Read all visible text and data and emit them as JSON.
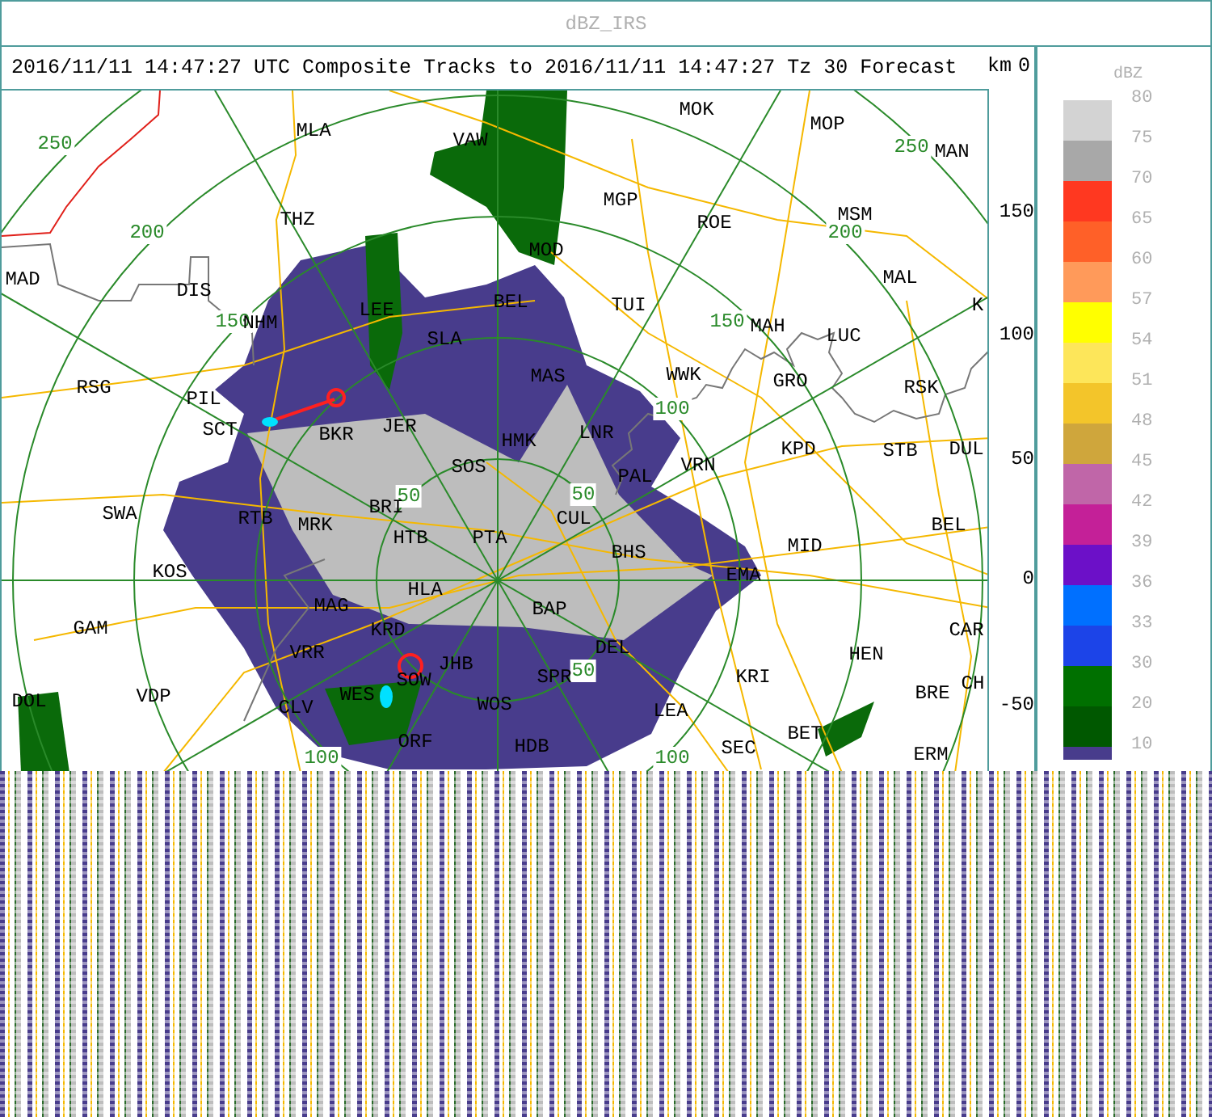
{
  "header": {
    "title": "dBZ_IRS"
  },
  "plot": {
    "title": "2016/11/11 14:47:27 UTC Composite Tracks to 2016/11/11 14:47:27 Tz 30 Forecast",
    "unit": "km",
    "corner_value": "0",
    "range_labels": [
      "250",
      "200",
      "150",
      "250",
      "200",
      "150",
      "100",
      "50",
      "100",
      "50",
      "50",
      "100"
    ],
    "stations": [
      "MOK",
      "MLA",
      "VAW",
      "MOP",
      "MAN",
      "MGP",
      "THZ",
      "ROE",
      "MSM",
      "MOD",
      "MAD",
      "MAL",
      "DIS",
      "LEE",
      "BEL",
      "TUI",
      "K",
      "NHM",
      "MAH",
      "SLA",
      "LUC",
      "MAS",
      "WWK",
      "GRO",
      "RSG",
      "RSK",
      "PIL",
      "SCT",
      "BKR",
      "JER",
      "HMK",
      "LNR",
      "KPD",
      "STB",
      "DUL",
      "SOS",
      "VRN",
      "PAL",
      "BRI",
      "SWA",
      "RTB",
      "MRK",
      "CUL",
      "BEL",
      "HTB",
      "PTA",
      "MID",
      "BHS",
      "KOS",
      "EMA",
      "HLA",
      "MAG",
      "BAP",
      "GAM",
      "KRD",
      "CAR",
      "VRR",
      "DEL",
      "HEN",
      "JHB",
      "SOW",
      "SPR",
      "KRI",
      "CH",
      "DOL",
      "VDP",
      "CLV",
      "WES",
      "WOS",
      "LEA",
      "BRE",
      "BET",
      "ORF",
      "HDB",
      "SEC",
      "ERM"
    ],
    "y_axis_labels": [
      "150",
      "100",
      "50",
      "0",
      "-50"
    ]
  },
  "legend": {
    "title": "dBZ",
    "bins": [
      {
        "label": "80",
        "color": "#d3d3d3"
      },
      {
        "label": "75",
        "color": "#a8a8a8"
      },
      {
        "label": "70",
        "color": "#ff3820"
      },
      {
        "label": "65",
        "color": "#ff6028"
      },
      {
        "label": "60",
        "color": "#ff9a5a"
      },
      {
        "label": "57",
        "color": "#ffff00"
      },
      {
        "label": "54",
        "color": "#fde65a"
      },
      {
        "label": "51",
        "color": "#f3c52a"
      },
      {
        "label": "48",
        "color": "#cfa63c"
      },
      {
        "label": "45",
        "color": "#c066a8"
      },
      {
        "label": "42",
        "color": "#c42098"
      },
      {
        "label": "39",
        "color": "#6c10c8"
      },
      {
        "label": "36",
        "color": "#0070ff"
      },
      {
        "label": "33",
        "color": "#1c44e8"
      },
      {
        "label": "30",
        "color": "#007000"
      },
      {
        "label": "20",
        "color": "#005800"
      },
      {
        "label": "10",
        "color": "#483c8c"
      }
    ]
  }
}
